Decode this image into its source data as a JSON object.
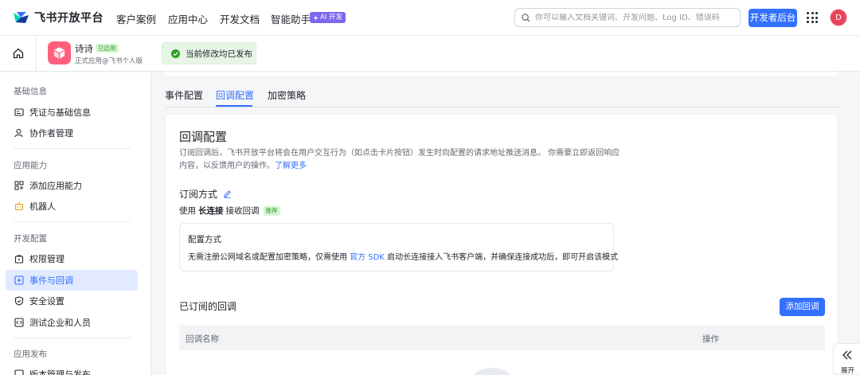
{
  "brand": {
    "name": "飞书开放平台"
  },
  "nav": {
    "items": [
      "客户案例",
      "应用中心",
      "开发文档",
      "智能助手"
    ],
    "ai_badge": "AI 开发"
  },
  "search": {
    "placeholder": "你可以输入文档关键词、开发问题、Log ID、错误码"
  },
  "dev_console_button": "开发者后台",
  "user": {
    "avatar_letter": "D"
  },
  "app": {
    "name": "诗诗",
    "status": "已启用",
    "subtitle": "正式应用@飞书个人版",
    "publish_notice": "当前修改均已发布"
  },
  "sidebar": {
    "groups": [
      {
        "title": "基础信息",
        "items": [
          "凭证与基础信息",
          "协作者管理"
        ]
      },
      {
        "title": "应用能力",
        "items": [
          "添加应用能力",
          "机器人"
        ]
      },
      {
        "title": "开发配置",
        "items": [
          "权限管理",
          "事件与回调",
          "安全设置",
          "测试企业和人员"
        ]
      },
      {
        "title": "应用发布",
        "items": [
          "版本管理与发布"
        ]
      }
    ],
    "active_item": "事件与回调"
  },
  "tabs": [
    "事件配置",
    "回调配置",
    "加密策略"
  ],
  "active_tab": "回调配置",
  "callback": {
    "title": "回调配置",
    "description": "订阅回调后，飞书开放平台将会在用户交互行为（如点击卡片按钮）发生时向配置的请求地址推送消息。 你需要立即返回响应内容，以反馈用户的操作。",
    "learn_more": "了解更多",
    "subscription_mode_label": "订阅方式",
    "use_prefix": "使用",
    "use_mode": "长连接",
    "use_suffix": "接收回调",
    "recommended": "推荐",
    "config_box": {
      "title": "配置方式",
      "desc_before": "无需注册公网域名或配置加密策略，仅需使用",
      "sdk_link": "官方 SDK",
      "desc_after": "启动长连接接入飞书客户端，并确保连接成功后，即可开启该模式"
    },
    "subscribed_title": "已订阅的回调",
    "add_button": "添加回调",
    "table_columns": [
      "回调名称",
      "操作"
    ]
  },
  "expand_label": "展开",
  "colors": {
    "accent": "#3370ff",
    "success": "#2ea121",
    "app_icon": "#ff5f7d",
    "avatar": "#e94459"
  }
}
